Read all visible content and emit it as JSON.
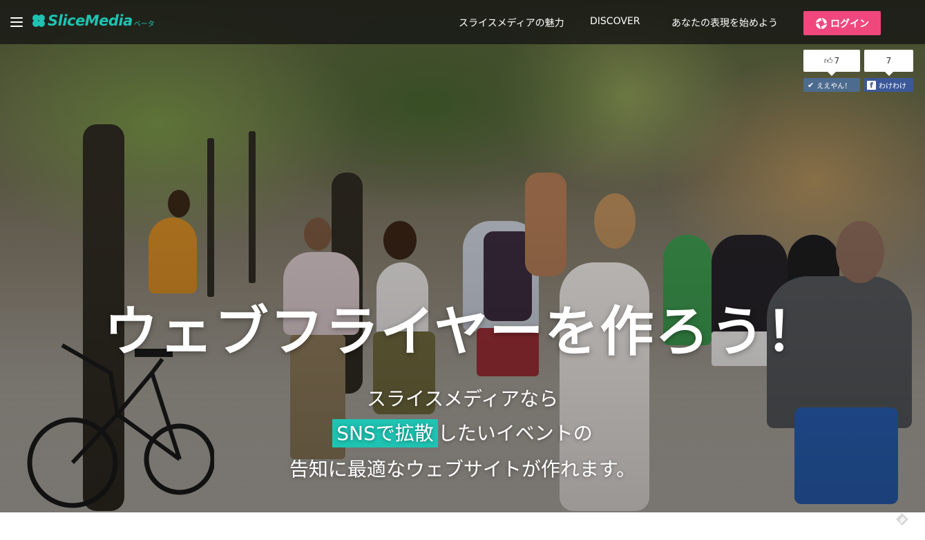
{
  "header": {
    "logo_text": "SliceMedia",
    "logo_beta": "ベータ",
    "nav": [
      {
        "label": "スライスメディアの魅力"
      },
      {
        "label": "DISCOVER"
      },
      {
        "label": "あなたの表現を始めよう"
      }
    ],
    "login_label": "ログイン",
    "colors": {
      "brand": "#1fc3b2",
      "login": "#f0477c",
      "bar": "#141414"
    }
  },
  "social": {
    "like_count": "7",
    "share_count": "7",
    "like_label": "ええやん！",
    "share_label": "わけわけ"
  },
  "hero": {
    "headline": "ウェブフライヤーを作ろう！",
    "line1": "スライスメディアなら",
    "line2_highlight": "SNSで拡散",
    "line2_rest": "したいイベントの",
    "line3": "告知に最適なウェブサイトが作れます。"
  }
}
